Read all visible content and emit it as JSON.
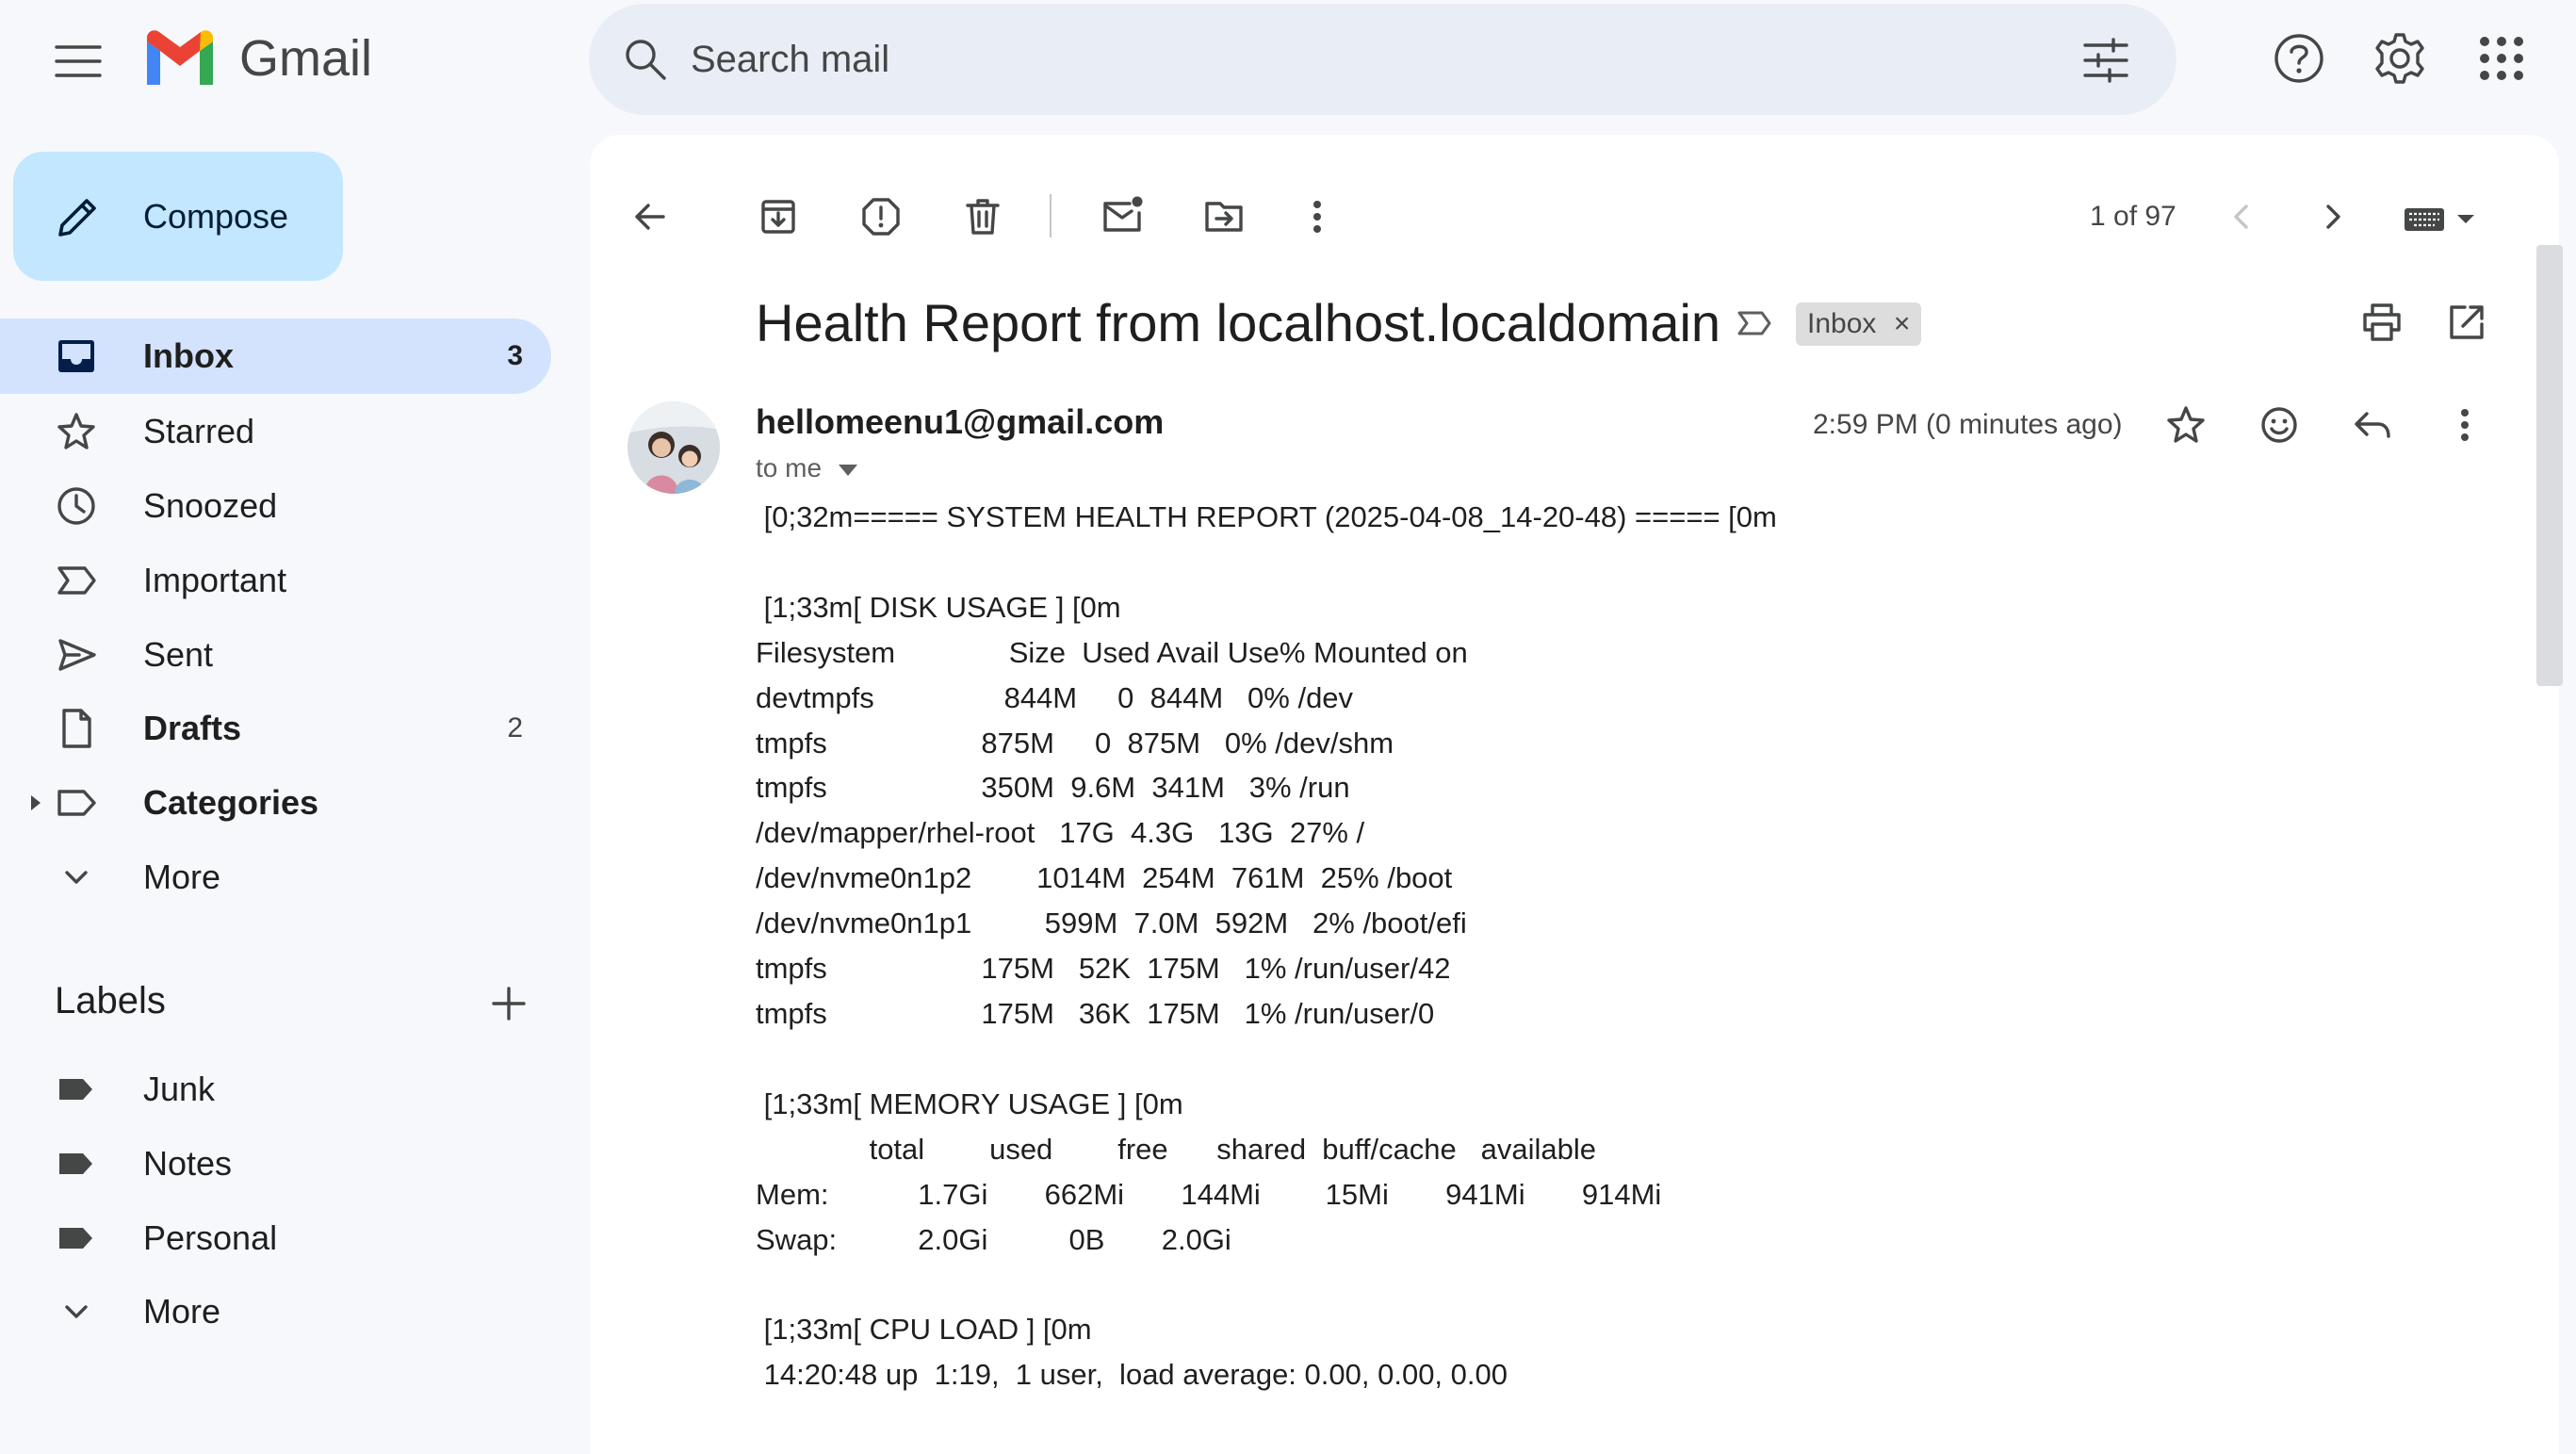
{
  "app": {
    "name": "Gmail",
    "brand_colors": {
      "blue": "#4285F4",
      "red": "#EA4335",
      "yellow": "#FBBC04",
      "green": "#34A853"
    }
  },
  "header": {
    "search_placeholder": "Search mail",
    "icons": [
      "main-menu-icon",
      "search-icon",
      "search-options-icon",
      "help-icon",
      "settings-icon",
      "apps-icon"
    ]
  },
  "sidebar": {
    "compose_label": "Compose",
    "items": [
      {
        "id": "inbox",
        "label": "Inbox",
        "count": "3",
        "active": true,
        "bold": true
      },
      {
        "id": "starred",
        "label": "Starred",
        "count": ""
      },
      {
        "id": "snoozed",
        "label": "Snoozed",
        "count": ""
      },
      {
        "id": "important",
        "label": "Important",
        "count": ""
      },
      {
        "id": "sent",
        "label": "Sent",
        "count": ""
      },
      {
        "id": "drafts",
        "label": "Drafts",
        "count": "2",
        "bold": true
      },
      {
        "id": "categories",
        "label": "Categories",
        "count": "",
        "bold": true
      },
      {
        "id": "more",
        "label": "More",
        "count": ""
      }
    ],
    "labels_heading": "Labels",
    "labels": [
      {
        "label": "Junk"
      },
      {
        "label": "Notes"
      },
      {
        "label": "Personal"
      },
      {
        "label": "More"
      }
    ]
  },
  "toolbar": {
    "pager_text": "1 of 97"
  },
  "email": {
    "subject": "Health Report from localhost.localdomain",
    "chip_label": "Inbox",
    "chip_close": "×",
    "sender": "hellomeenu1@gmail.com",
    "to_line": "to me",
    "timestamp": "2:59 PM (0 minutes ago)",
    "body": " [0;32m===== SYSTEM HEALTH REPORT (2025-04-08_14-20-48) ===== [0m\n\n [1;33m[ DISK USAGE ] [0m\nFilesystem              Size  Used Avail Use% Mounted on\ndevtmpfs                844M     0  844M   0% /dev\ntmpfs                   875M     0  875M   0% /dev/shm\ntmpfs                   350M  9.6M  341M   3% /run\n/dev/mapper/rhel-root   17G  4.3G   13G  27% /\n/dev/nvme0n1p2        1014M  254M  761M  25% /boot\n/dev/nvme0n1p1         599M  7.0M  592M   2% /boot/efi\ntmpfs                   175M   52K  175M   1% /run/user/42\ntmpfs                   175M   36K  175M   1% /run/user/0\n\n [1;33m[ MEMORY USAGE ] [0m\n              total        used        free      shared  buff/cache   available\nMem:           1.7Gi       662Mi       144Mi        15Mi       941Mi       914Mi\nSwap:          2.0Gi          0B       2.0Gi\n\n [1;33m[ CPU LOAD ] [0m\n 14:20:48 up  1:19,  1 user,  load average: 0.00, 0.00, 0.00"
  }
}
